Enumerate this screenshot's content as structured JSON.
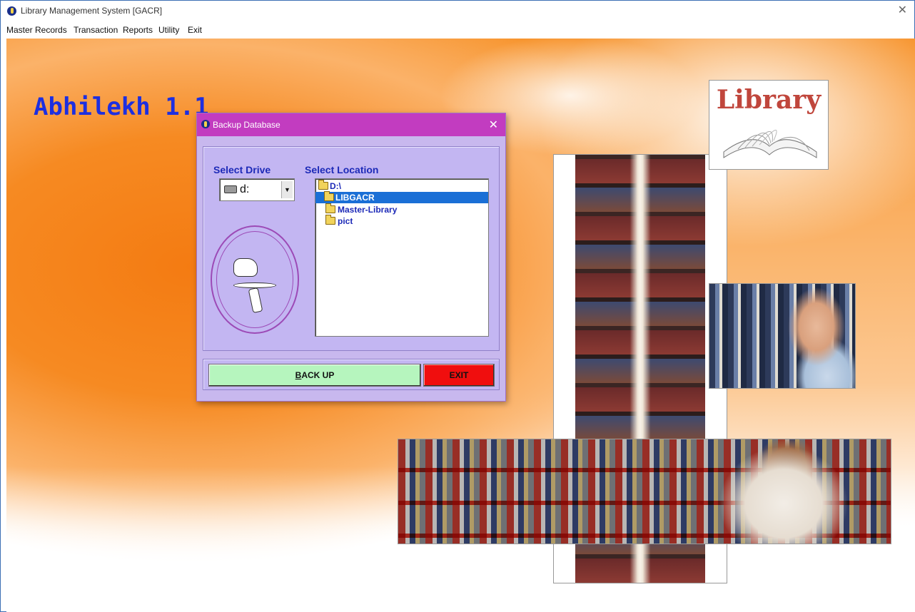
{
  "window": {
    "title": "Library Management System  [GACR]",
    "close_glyph": "✕"
  },
  "menubar": {
    "items": [
      "Master Records",
      "Transaction",
      "Reports",
      "Utility",
      "Exit"
    ]
  },
  "desktop": {
    "brand": "Abhilekh 1.1",
    "library_logo_text": "Library"
  },
  "dialog": {
    "title": "Backup Database",
    "close_glyph": "✕",
    "select_drive_label": "Select Drive",
    "select_location_label": "Select Location",
    "drive_value": "d:",
    "drive_arrow": "▼",
    "locations": [
      {
        "label": "D:\\",
        "selected": false,
        "icon": "open-folder-icon"
      },
      {
        "label": "LIBGACR",
        "selected": true,
        "icon": "open-folder-icon"
      },
      {
        "label": "Master-Library",
        "selected": false,
        "icon": "folder-icon"
      },
      {
        "label": "pict",
        "selected": false,
        "icon": "folder-icon"
      }
    ],
    "backup_button": "BACK UP",
    "exit_button": "EXIT"
  },
  "colors": {
    "dialog_titlebar": "#c23cc0",
    "dialog_body": "#c8b8ee",
    "label_blue": "#1d2ab8",
    "brand_blue": "#1d2fe0",
    "backup_green": "#b6f5be",
    "exit_red": "#f00e0e",
    "selection_blue": "#1a6fd6"
  }
}
